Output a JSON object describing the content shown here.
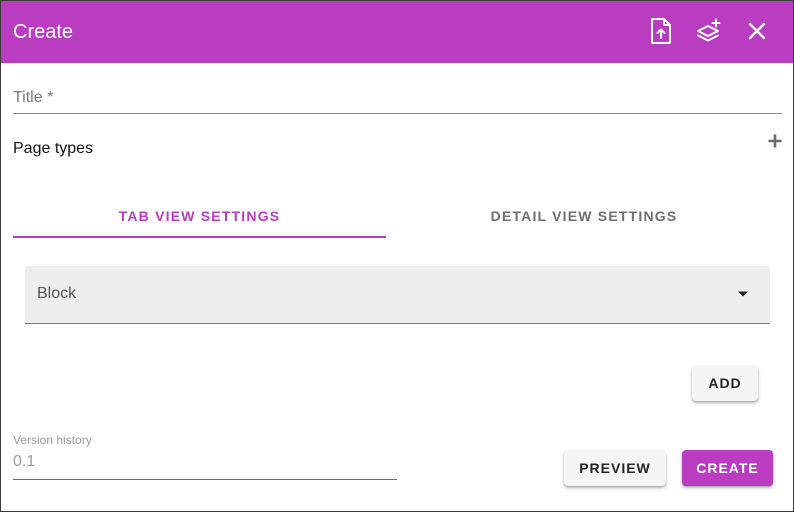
{
  "dialog": {
    "title": "Create"
  },
  "icons": {
    "upload": "file-upload-icon",
    "layers": "layers-add-icon",
    "close": "close-icon",
    "add_page_type": "plus-icon",
    "dropdown": "dropdown-arrow-icon"
  },
  "form": {
    "title_placeholder": "Title *",
    "page_types_label": "Page types"
  },
  "tabs": [
    {
      "label": "Tab view settings",
      "active": true
    },
    {
      "label": "Detail view settings",
      "active": false
    }
  ],
  "block_select": {
    "selected": "Block"
  },
  "buttons": {
    "add": "Add",
    "preview": "Preview",
    "create": "Create"
  },
  "version": {
    "label": "Version history",
    "value": "0.1"
  },
  "colors": {
    "accent": "#b93cc1",
    "header_text": "#ffffff",
    "inactive_tab": "#6f6f6f",
    "select_background": "#eeeeee"
  }
}
